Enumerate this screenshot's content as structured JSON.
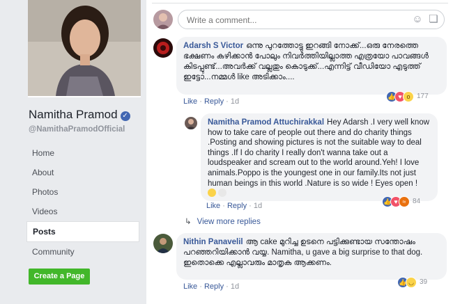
{
  "page": {
    "name": "Namitha Pramod",
    "handle": "@NamithaPramodOfficial"
  },
  "nav": [
    {
      "label": "Home"
    },
    {
      "label": "About"
    },
    {
      "label": "Photos"
    },
    {
      "label": "Videos"
    },
    {
      "label": "Posts",
      "active": true
    },
    {
      "label": "Community"
    }
  ],
  "create_page_label": "Create a Page",
  "composer": {
    "placeholder": "Write a comment...",
    "icons": [
      "emoji-icon",
      "sticker-icon"
    ]
  },
  "comments": [
    {
      "author": "Adarsh S Victor",
      "text": "ഒന്നു പുറത്തോട്ടു ഇറങ്ങി നോക്ക്...ഒരു നേരത്തെ ഭക്ഷണം കഴിക്കാൻ പോലും നിവർത്തിയില്ലാത്ത എത്രയോ പാവങ്ങൾ കിടപ്പുണ്ട്...അവർക്ക് വല്ലതും കൊടുക്ക്...എന്നിട്ട് വീഡിയോ എടുത്ത് ഇട്ടോ...നമ്മൾ like അടിക്കാം....",
      "like": "Like",
      "reply": "Reply",
      "time": "1d",
      "reaction_count": "177"
    },
    {
      "author": "Namitha Pramod Attuchirakkal",
      "text": "Hey Adarsh .I very well know how to take care of people out there and do charity things .Posting and showing pictures is not the suitable way to deal things .If I do charity I really don't wanna take out a loudspeaker and scream out to the world around.Yeh! I love animals.Poppo is the youngest one in our family.Its not just human beings in this world .Nature is so wide ! Eyes open !",
      "like": "Like",
      "reply": "Reply",
      "time": "1d",
      "reaction_count": "84"
    },
    {
      "author": "Nithin Panavelil",
      "text": "ആ cake മുറിച്ച ഉടനെ പട്ടിക്കുണ്ടായ സന്തോഷം പറഞ്ഞറിയിക്കാൻ വയ്യ. Namitha, u gave a big surprise to that dog. ഇതൊക്കെ എല്ലാവരും മാതൃക ആക്കണം.",
      "like": "Like",
      "reply": "Reply",
      "time": "1d",
      "reaction_count": "39"
    }
  ],
  "view_more_replies": "View more replies",
  "colors": {
    "link": "#385898",
    "bubble": "#f2f3f5",
    "create_btn": "#42b72a",
    "like_blue": "#4267b2",
    "love_red": "#f25268",
    "wow_yellow": "#fbd34a"
  }
}
